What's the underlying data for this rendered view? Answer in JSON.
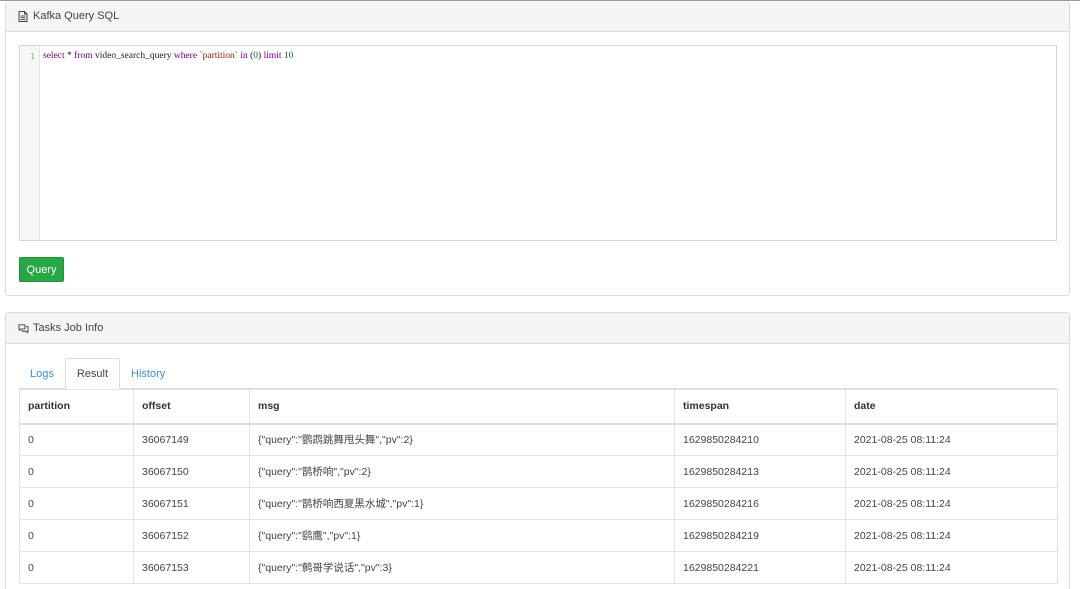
{
  "sql_panel": {
    "title": "Kafka Query SQL",
    "icon": "file-text-icon",
    "editor": {
      "line_number": "1",
      "code_tokens": [
        {
          "t": "select",
          "c": "kw"
        },
        {
          "t": " * ",
          "c": ""
        },
        {
          "t": "from",
          "c": "kw"
        },
        {
          "t": " video_search_query ",
          "c": ""
        },
        {
          "t": "where",
          "c": "kw"
        },
        {
          "t": " ",
          "c": ""
        },
        {
          "t": "`partition`",
          "c": "str"
        },
        {
          "t": " ",
          "c": ""
        },
        {
          "t": "in",
          "c": "kw"
        },
        {
          "t": " (",
          "c": ""
        },
        {
          "t": "0",
          "c": "num"
        },
        {
          "t": ") ",
          "c": ""
        },
        {
          "t": "limit",
          "c": "kw"
        },
        {
          "t": " ",
          "c": ""
        },
        {
          "t": "10",
          "c": "num"
        }
      ]
    },
    "query_button": "Query"
  },
  "tasks_panel": {
    "title": "Tasks Job Info",
    "icon": "comments-icon",
    "tabs": [
      {
        "label": "Logs",
        "active": false
      },
      {
        "label": "Result",
        "active": true
      },
      {
        "label": "History",
        "active": false
      }
    ],
    "table": {
      "columns": [
        "partition",
        "offset",
        "msg",
        "timespan",
        "date"
      ],
      "rows": [
        [
          "0",
          "36067149",
          "{\"query\":\"鹦鹉跳舞甩头舞\",\"pv\":2}",
          "1629850284210",
          "2021-08-25 08:11:24"
        ],
        [
          "0",
          "36067150",
          "{\"query\":\"鹊桥响\",\"pv\":2}",
          "1629850284213",
          "2021-08-25 08:11:24"
        ],
        [
          "0",
          "36067151",
          "{\"query\":\"鹊桥响西夏黑水城\",\"pv\":1}",
          "1629850284216",
          "2021-08-25 08:11:24"
        ],
        [
          "0",
          "36067152",
          "{\"query\":\"鹞鹰\",\"pv\":1}",
          "1629850284219",
          "2021-08-25 08:11:24"
        ],
        [
          "0",
          "36067153",
          "{\"query\":\"鹩哥学说话\",\"pv\":3}",
          "1629850284221",
          "2021-08-25 08:11:24"
        ]
      ]
    }
  }
}
